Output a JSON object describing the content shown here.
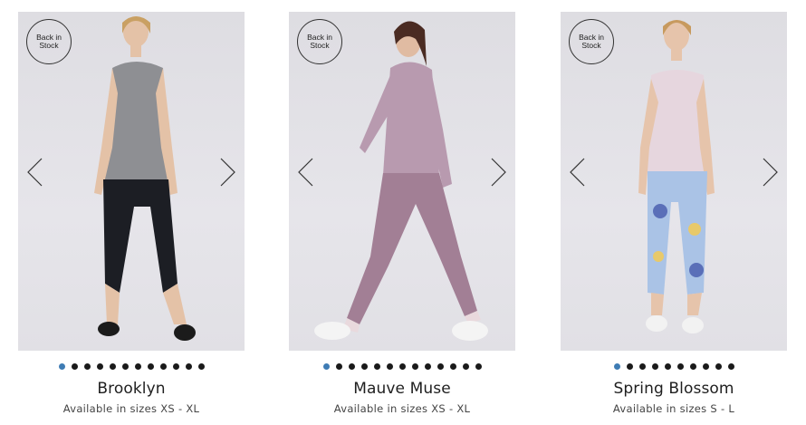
{
  "products": [
    {
      "badge": "Back in Stock",
      "name": "Brooklyn",
      "sizes": "Available in sizes XS - XL",
      "dot_count": 12,
      "active_dot": 0,
      "image": {
        "top_color": "#8e8f93",
        "bottom_color": "#1c1e24",
        "accent": "#2a2c33"
      }
    },
    {
      "badge": "Back in Stock",
      "name": "Mauve Muse",
      "sizes": "Available in sizes XS - XL",
      "dot_count": 13,
      "active_dot": 0,
      "image": {
        "top_color": "#b89aaf",
        "bottom_color": "#a27f95",
        "accent": "#e9d9dd"
      }
    },
    {
      "badge": "Back in Stock",
      "name": "Spring Blossom",
      "sizes": "Available in sizes S - L",
      "dot_count": 10,
      "active_dot": 0,
      "image": {
        "top_color": "#e6d6de",
        "bottom_color": "#aac3e6",
        "accent": "#5a6fb8"
      }
    }
  ],
  "icons": {
    "prev": "chevron-left-icon",
    "next": "chevron-right-icon"
  },
  "colors": {
    "active_dot": "#3e7cb4",
    "dot": "#1a1a1a"
  }
}
